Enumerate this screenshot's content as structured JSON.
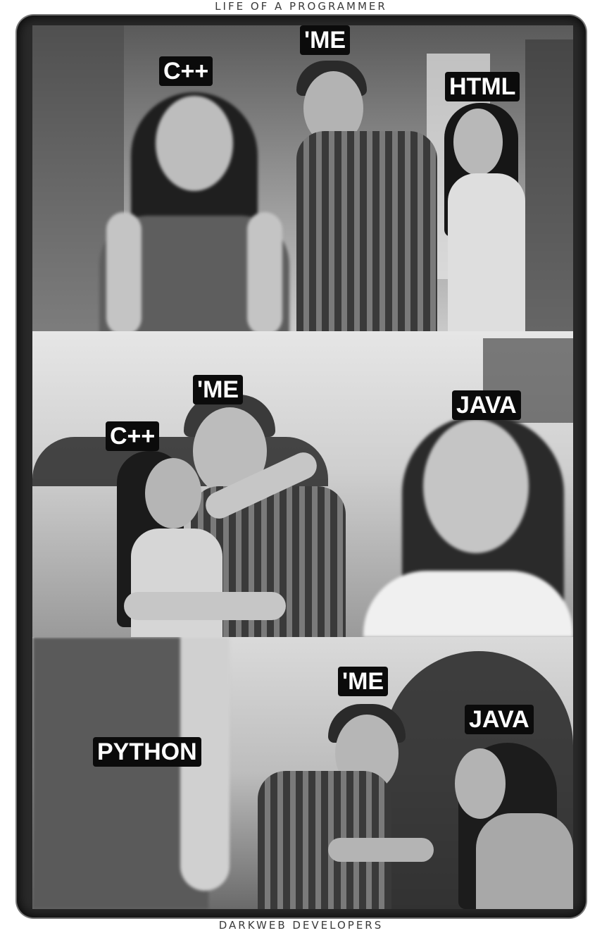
{
  "header": {
    "title": "LIFE OF A PROGRAMMER"
  },
  "footer": {
    "credit": "DARKWEB DEVELOPERS"
  },
  "panels": [
    {
      "labels": {
        "left": "C++",
        "center": "'ME",
        "right": "HTML"
      }
    },
    {
      "labels": {
        "left": "C++",
        "center": "'ME",
        "right": "JAVA"
      }
    },
    {
      "labels": {
        "left": "PYTHON",
        "center": "'ME",
        "right": "JAVA"
      }
    }
  ]
}
